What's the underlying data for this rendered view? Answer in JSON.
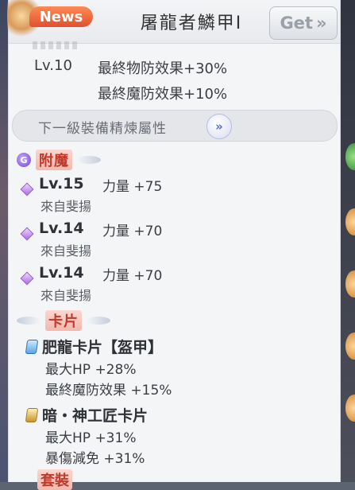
{
  "header": {
    "news_label": "News",
    "title": "屠龍者鱗甲Ⅰ",
    "get_label": "Get",
    "get_chevron": "»"
  },
  "refine": {
    "rows": [
      {
        "level": "Lv.10",
        "effect": "最終物防效果+30%"
      },
      {
        "level": "",
        "effect": "最終魔防效果+10%"
      }
    ],
    "next_label": "下一級裝備精煉屬性",
    "next_btn": "»"
  },
  "enchant": {
    "title": "附魔",
    "icon_glyph": "G",
    "items": [
      {
        "level": "Lv.15",
        "stat": "力量 +75",
        "source": "來自斐揚"
      },
      {
        "level": "Lv.14",
        "stat": "力量 +70",
        "source": "來自斐揚"
      },
      {
        "level": "Lv.14",
        "stat": "力量 +70",
        "source": "來自斐揚"
      }
    ]
  },
  "cards": {
    "title": "卡片",
    "items": [
      {
        "name": "肥龍卡片【盔甲】",
        "stats": [
          "最大HP +28%",
          "最終魔防效果 +15%"
        ]
      },
      {
        "name": "暗・神工匠卡片",
        "stats": [
          "最大HP +31%",
          "暴傷減免 +31%"
        ]
      }
    ]
  },
  "set": {
    "title": "套裝"
  },
  "colors": {
    "accent_red": "#c0392b",
    "news_orange": "#e0502f",
    "enchant_purple": "#6f42d6",
    "card_blue": "#2f6fb0"
  }
}
